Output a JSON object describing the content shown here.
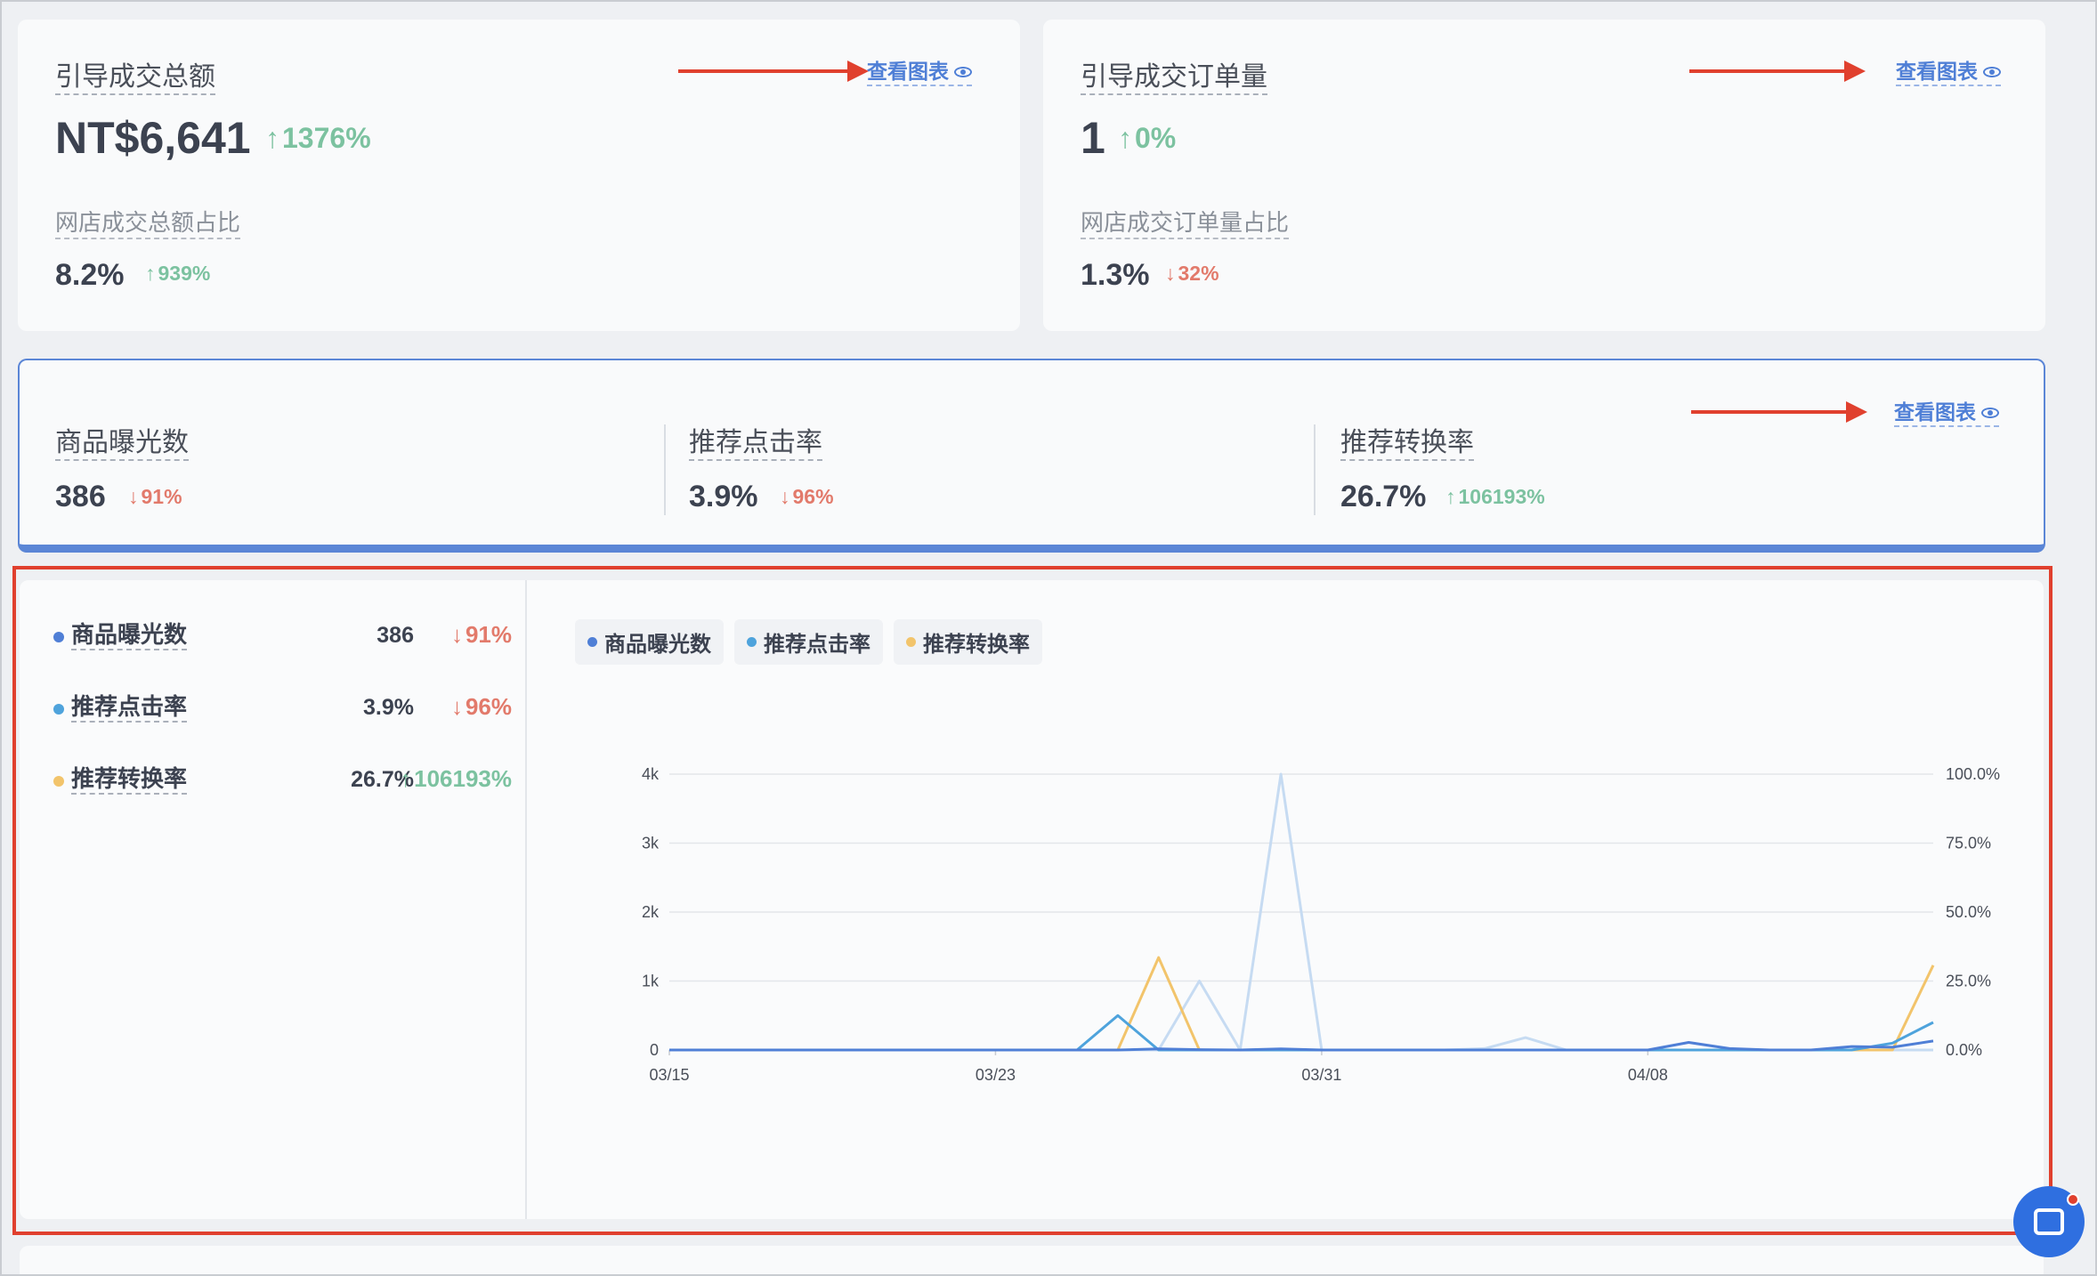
{
  "view_chart_label": "查看图表",
  "card_gmv": {
    "label": "引导成交总额",
    "value": "NT$6,641",
    "change": "1376%",
    "change_dir": "up",
    "sub_label": "网店成交总额占比",
    "sub_value": "8.2%",
    "sub_change": "939%",
    "sub_change_dir": "up"
  },
  "card_orders": {
    "label": "引导成交订单量",
    "value": "1",
    "change": "0%",
    "change_dir": "up",
    "sub_label": "网店成交订单量占比",
    "sub_value": "1.3%",
    "sub_change": "32%",
    "sub_change_dir": "down"
  },
  "metrics": [
    {
      "label": "商品曝光数",
      "value": "386",
      "change": "91%",
      "dir": "down",
      "color": "#4f7fd6"
    },
    {
      "label": "推荐点击率",
      "value": "3.9%",
      "change": "96%",
      "dir": "down",
      "color": "#4ea3dc"
    },
    {
      "label": "推荐转换率",
      "value": "26.7%",
      "change": "106193%",
      "dir": "up",
      "color": "#f2c46b"
    }
  ],
  "icons": {
    "up_arrow": "↑",
    "down_arrow": "↓",
    "eye": "eye-icon",
    "help": "chat-help-icon"
  },
  "colors": {
    "accent": "#4f7fd6",
    "up": "#7cc2a0",
    "down": "#e27a6b",
    "annotation": "#e0402e"
  },
  "chart_data": {
    "type": "line",
    "x_tick_labels": [
      "03/15",
      "03/23",
      "03/31",
      "04/08"
    ],
    "y_left_ticks": [
      "0",
      "1k",
      "2k",
      "3k",
      "4k"
    ],
    "y_right_ticks": [
      "0.0%",
      "25.0%",
      "50.0%",
      "75.0%",
      "100.0%"
    ],
    "ylim_left": [
      0,
      4000
    ],
    "ylim_right": [
      0,
      100
    ],
    "x": [
      "03/15",
      "03/16",
      "03/17",
      "03/18",
      "03/19",
      "03/20",
      "03/21",
      "03/22",
      "03/23",
      "03/24",
      "03/25",
      "03/26",
      "03/27",
      "03/28",
      "03/29",
      "03/30",
      "03/31",
      "04/01",
      "04/02",
      "04/03",
      "04/04",
      "04/05",
      "04/06",
      "04/07",
      "04/08",
      "04/09",
      "04/10",
      "04/11",
      "04/12",
      "04/13",
      "04/14",
      "04/15"
    ],
    "grid": true,
    "series": [
      {
        "name": "商品曝光数",
        "axis": "left",
        "color": "#4f7fd6",
        "values": [
          0,
          0,
          0,
          0,
          0,
          0,
          0,
          0,
          0,
          0,
          0,
          0,
          15,
          5,
          0,
          15,
          0,
          0,
          0,
          0,
          0,
          0,
          0,
          0,
          0,
          110,
          20,
          0,
          0,
          50,
          40,
          130
        ]
      },
      {
        "name": "",
        "axis": "left",
        "color": "#c6dbf2",
        "values": [
          0,
          0,
          0,
          0,
          0,
          0,
          0,
          0,
          0,
          0,
          0,
          0,
          0,
          1000,
          0,
          4000,
          0,
          0,
          0,
          0,
          20,
          180,
          0,
          0,
          0,
          0,
          0,
          0,
          0,
          0,
          0,
          0
        ]
      },
      {
        "name": "推荐点击率",
        "axis": "right",
        "color": "#4ea3dc",
        "values": [
          0,
          0,
          0,
          0,
          0,
          0,
          0,
          0,
          0,
          0,
          0,
          12.5,
          0,
          0,
          0,
          0,
          0,
          0,
          0,
          0,
          0,
          0,
          0,
          0,
          0,
          0,
          0,
          0,
          0,
          0,
          2.5,
          10
        ]
      },
      {
        "name": "推荐转换率",
        "axis": "right",
        "color": "#f2c46b",
        "values": [
          0,
          0,
          0,
          0,
          0,
          0,
          0,
          0,
          0,
          0,
          0,
          0,
          33.5,
          0,
          0,
          0,
          0,
          0,
          0,
          0,
          0,
          0,
          0,
          0,
          0,
          0,
          0,
          0,
          0,
          0,
          0,
          30.7
        ]
      }
    ]
  }
}
